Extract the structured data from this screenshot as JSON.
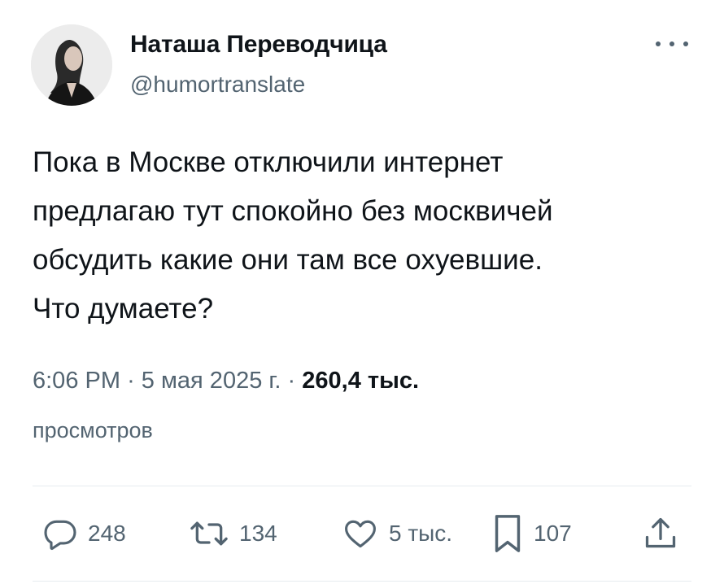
{
  "tweet": {
    "author_name": "Наташа Переводчица",
    "author_handle": "@humortranslate",
    "text": "Пока в Москве отключили интернет\nпредлагаю тут спокойно без москвичей\nобсудить какие они там все охуевшие.\nЧто думаете?",
    "time": "6:06 PM",
    "date": "5 мая 2025 г.",
    "separator": "·",
    "views_count": "260,4 тыс.",
    "views_label": "просмотров"
  },
  "actions": {
    "reply_count": "248",
    "retweet_count": "134",
    "like_count": "5 тыс.",
    "bookmark_count": "107"
  },
  "icons": {
    "more": "more-horizontal-icon",
    "reply": "reply-icon",
    "retweet": "retweet-icon",
    "like": "heart-icon",
    "bookmark": "bookmark-icon",
    "share": "share-icon"
  },
  "colors": {
    "text": "#0f1419",
    "secondary": "#536471",
    "divider": "#e6ecf0"
  }
}
